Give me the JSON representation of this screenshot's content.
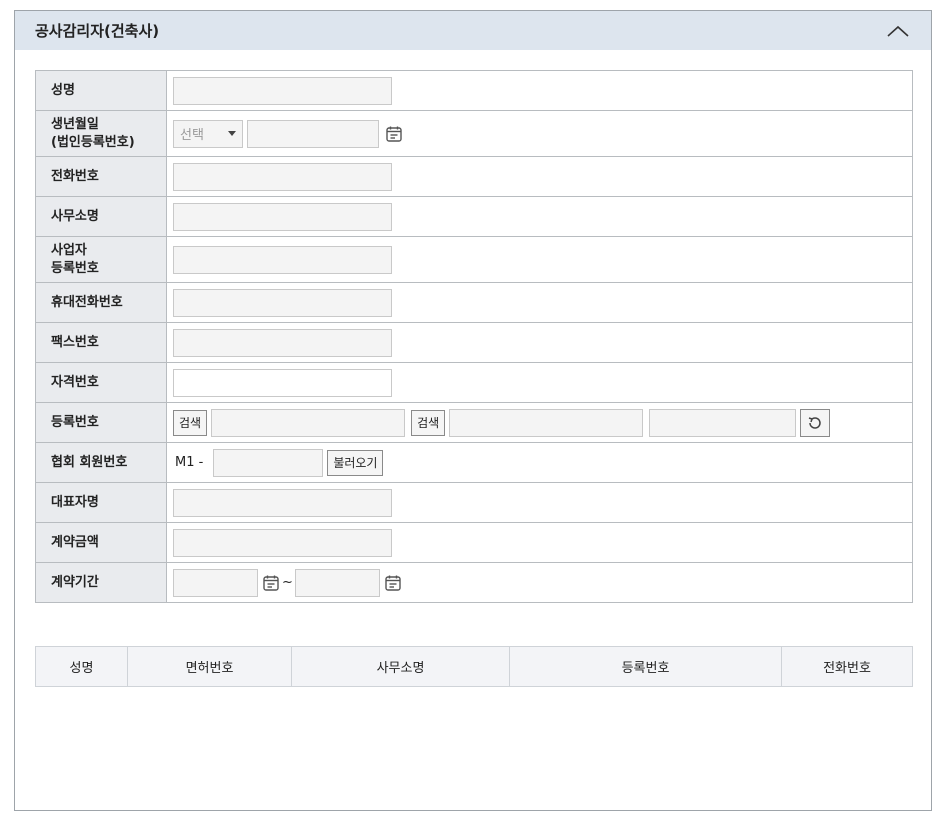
{
  "panel": {
    "title": "공사감리자(건축사)"
  },
  "icons": {
    "collapse": "chevron-up-icon",
    "calendar": "calendar-icon",
    "refresh": "refresh-icon",
    "select_caret": "caret-down-icon"
  },
  "form": {
    "name_label": "성명",
    "birth_label_line1": "생년월일",
    "birth_label_line2": "(법인등록번호)",
    "birth_select": "선택",
    "phone_label": "전화번호",
    "office_label": "사무소명",
    "biz_label_line1": "사업자",
    "biz_label_line2": "등록번호",
    "mobile_label": "휴대전화번호",
    "fax_label": "팩스번호",
    "license_label": "자격번호",
    "regno_label": "등록번호",
    "search_btn1": "검색",
    "search_btn2": "검색",
    "assoc_label": "협회 회원번호",
    "assoc_prefix": "M1 -",
    "load_btn": "불러오기",
    "rep_label": "대표자명",
    "amount_label": "계약금액",
    "period_label": "계약기간",
    "period_sep": "~"
  },
  "list": {
    "columns": [
      "성명",
      "면허번호",
      "사무소명",
      "등록번호",
      "전화번호"
    ]
  }
}
